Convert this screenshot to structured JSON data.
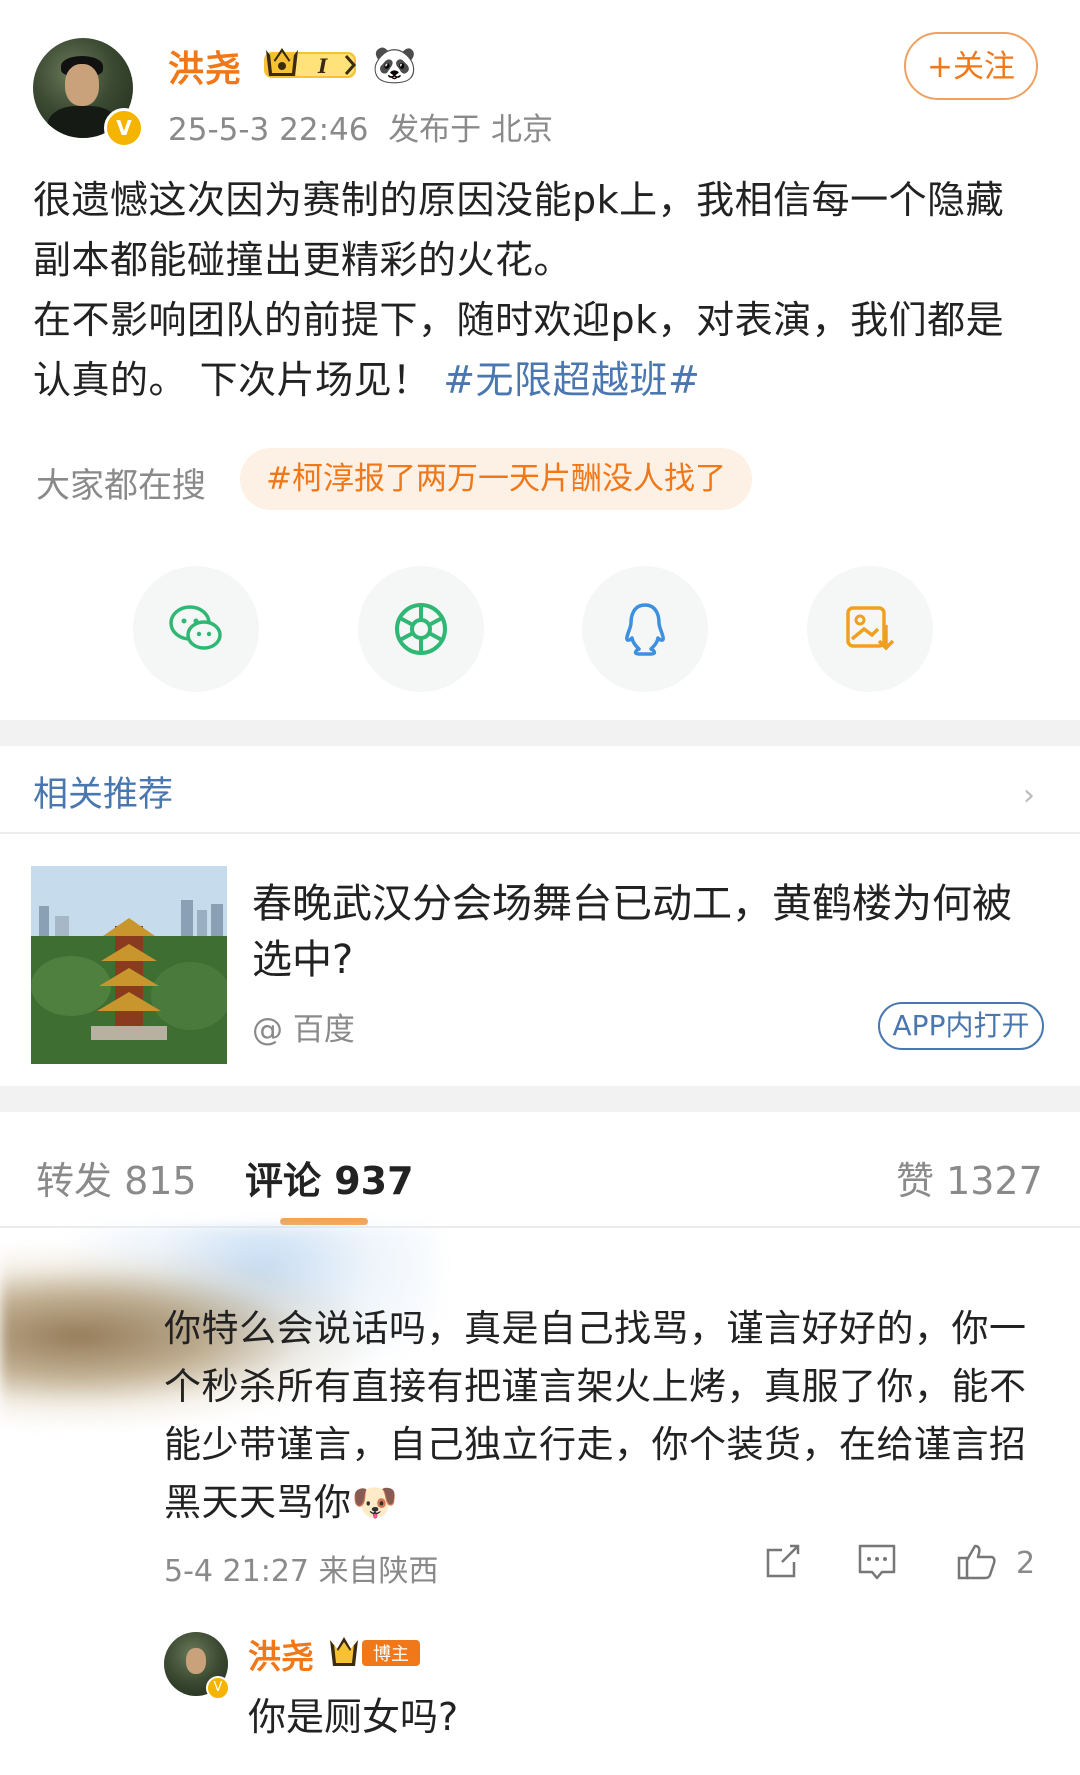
{
  "post": {
    "author": "洪尧",
    "timestamp": "25-5-3 22:46",
    "location": "发布于 北京",
    "follow_label": "+关注",
    "text_part1": "很遗憾这次因为赛制的原因没能pk上，我相信每一个隐藏副本都能碰撞出更精彩的火花。",
    "text_part2": "在不影响团队的前提下，随时欢迎pk，对表演，我们都是认真的。 下次片场见！",
    "topic": "#无限超越班#",
    "badge_level": "I"
  },
  "search": {
    "label": "大家都在搜",
    "pill": "#柯淳报了两万一天片酬没人找了"
  },
  "share": {
    "icons": [
      "wechat-icon",
      "moments-icon",
      "qq-icon",
      "save-image-icon"
    ]
  },
  "recommend": {
    "title": "相关推荐",
    "news_title": "春晚武汉分会场舞台已动工，黄鹤楼为何被选中?",
    "source": "@ 百度",
    "app_button": "APP内打开"
  },
  "tabs": {
    "repost": "转发 815",
    "comments": "评论 937",
    "likes": "赞 1327"
  },
  "comment": {
    "text": "你特么会说话吗，真是自己找骂，谨言好好的，你一个秒杀所有直接有把谨言架火上烤，真服了你，能不能少带谨言，自己独立行走，你个装货，在给谨言招黑天天骂你🐶",
    "meta": "5-4 21:27 来自陕西",
    "like_count": "2"
  },
  "reply": {
    "author": "洪尧",
    "badge": "博主",
    "text": "你是厕女吗?"
  },
  "colors": {
    "accent": "#f07818",
    "link": "#4a77b0",
    "gray_text": "#8a8a8a"
  }
}
